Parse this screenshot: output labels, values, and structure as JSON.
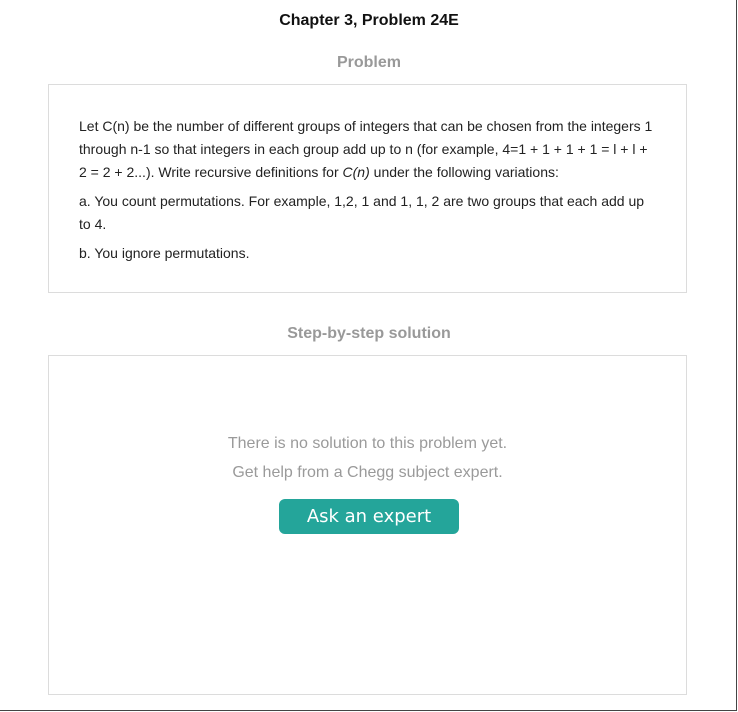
{
  "header": {
    "title": "Chapter 3, Problem 24E"
  },
  "problem": {
    "heading": "Problem",
    "statement": {
      "pre": "Let  C(n) be the number of different groups of integers that can be chosen from the integers 1 through n-1 so that integers in each group add up to n (for example, 4=1 + 1 + 1 + 1 = l + l + 2 = 2 + 2...). Write recursive definitions for ",
      "math": "C(n)",
      "post": " under the following variations:"
    },
    "part_a": "a. You count permutations. For example, 1,2, 1 and 1, 1, 2 are two groups that each add up to 4.",
    "part_b": "b. You ignore permutations."
  },
  "solution": {
    "heading": "Step-by-step solution",
    "empty_line1": "There is no solution to this problem yet.",
    "empty_line2": "Get help from a Chegg subject expert.",
    "ask_button_label": "Ask an expert"
  },
  "colors": {
    "accent": "#24a59a",
    "heading_gray": "#999999",
    "muted_text": "#9a9a9a",
    "card_border": "#dcdcdc"
  }
}
